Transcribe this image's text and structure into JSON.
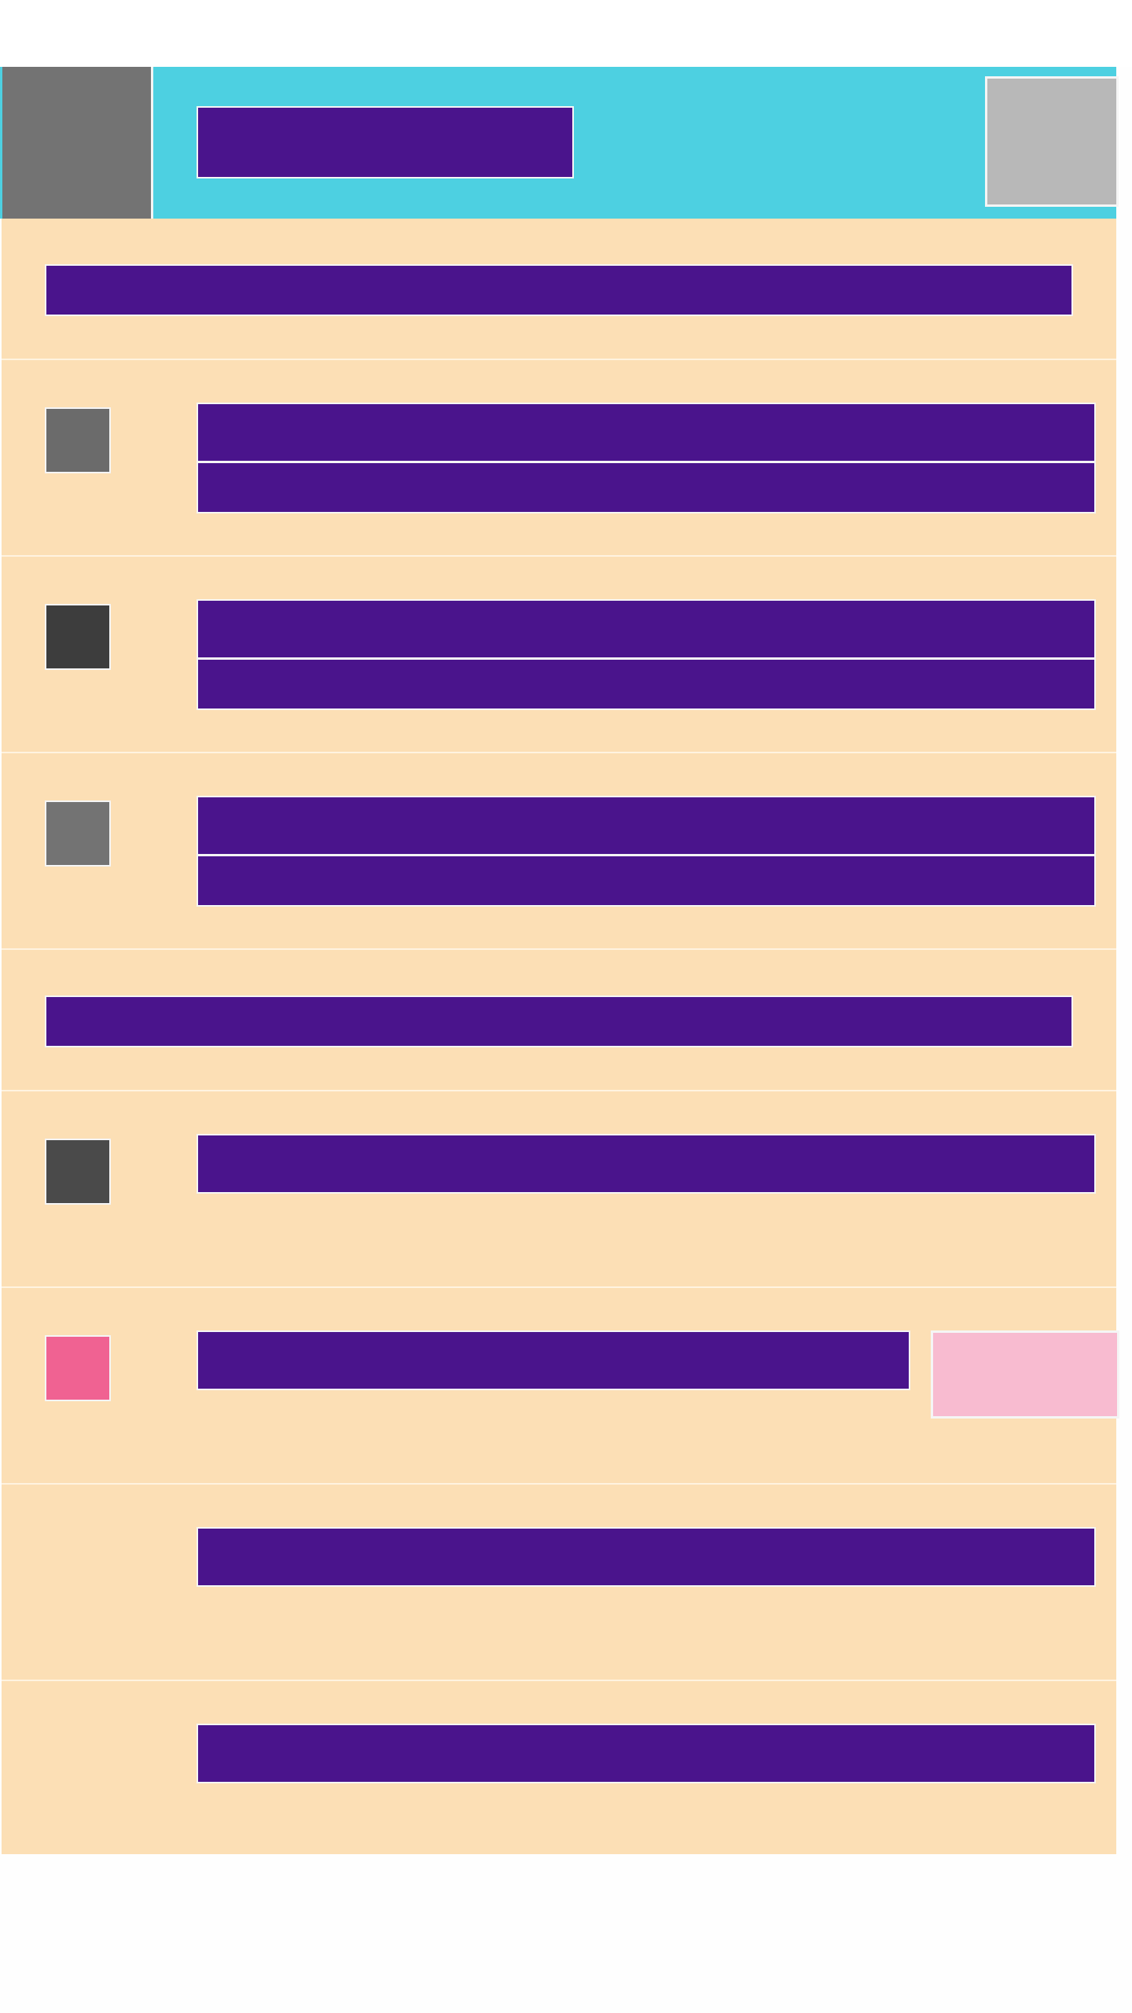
{
  "colors": {
    "app_bar": "#4dd0e1",
    "list_background": "#fcdfb5",
    "text_block": "#4a148c",
    "nav_button": "#737373",
    "action_button": "#b8b8b8",
    "badge": "#f8bbd0"
  },
  "toolbar": {
    "title": "",
    "nav_icon": "nav-icon",
    "action_icon": "action-icon"
  },
  "list": [
    {
      "kind": "header",
      "title": ""
    },
    {
      "kind": "item",
      "icon": "item-icon",
      "icon_color": "#6b6b6b",
      "primary": "",
      "secondary": ""
    },
    {
      "kind": "item",
      "icon": "item-icon",
      "icon_color": "#3d3d3d",
      "primary": "",
      "secondary": ""
    },
    {
      "kind": "item",
      "icon": "item-icon",
      "icon_color": "#737373",
      "primary": "",
      "secondary": ""
    },
    {
      "kind": "header",
      "title": ""
    },
    {
      "kind": "item",
      "icon": "item-icon",
      "icon_color": "#4a4a4a",
      "primary": ""
    },
    {
      "kind": "item",
      "icon": "item-icon",
      "icon_color": "#f06292",
      "primary": "",
      "badge": ""
    },
    {
      "kind": "item",
      "primary": ""
    },
    {
      "kind": "item",
      "primary": ""
    }
  ]
}
